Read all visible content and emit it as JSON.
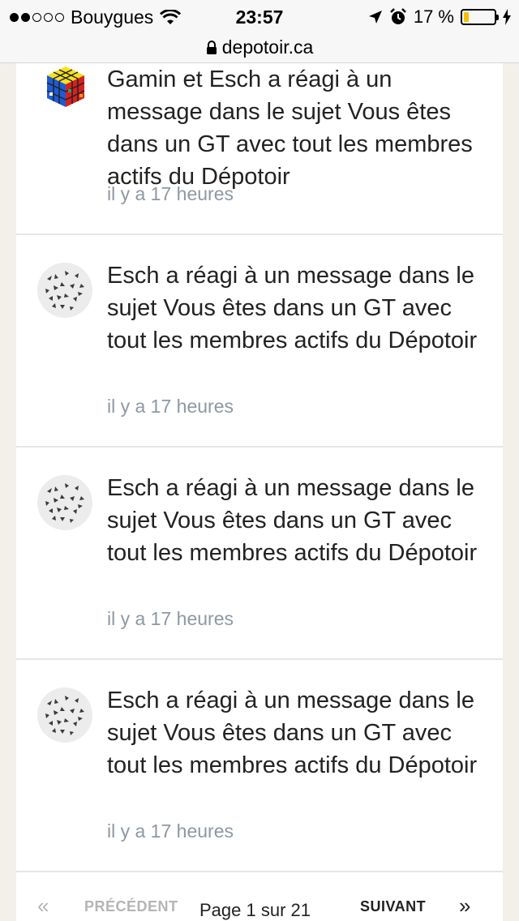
{
  "status_bar": {
    "carrier": "Bouygues",
    "time": "23:57",
    "battery_text": "17 %",
    "battery_level": 0.17
  },
  "url_bar": {
    "domain": "depotoir.ca"
  },
  "notifications": [
    {
      "message": "Gamin et Esch a réagi à un message dans le sujet Vous êtes dans un GT avec tout les membres actifs du Dépotoir",
      "time": "il y a 17 heures",
      "avatar": "rubiks-cube"
    },
    {
      "message": "Esch a réagi à un message dans le sujet Vous êtes dans un GT avec tout les membres actifs du Dépotoir",
      "time": "il y a 17 heures",
      "avatar": "butterflies"
    },
    {
      "message": "Esch a réagi à un message dans le sujet Vous êtes dans un GT avec tout les membres actifs du Dépotoir",
      "time": "il y a 17 heures",
      "avatar": "butterflies"
    },
    {
      "message": "Esch a réagi à un message dans le sujet Vous êtes dans un GT avec tout les membres actifs du Dépotoir",
      "time": "il y a 17 heures",
      "avatar": "butterflies"
    }
  ],
  "pagination": {
    "prev_arrow": "«",
    "prev_label": "PRÉCÉDENT",
    "page_text": "Page 1 sur 21",
    "next_label": "SUIVANT",
    "next_arrow": "»"
  }
}
